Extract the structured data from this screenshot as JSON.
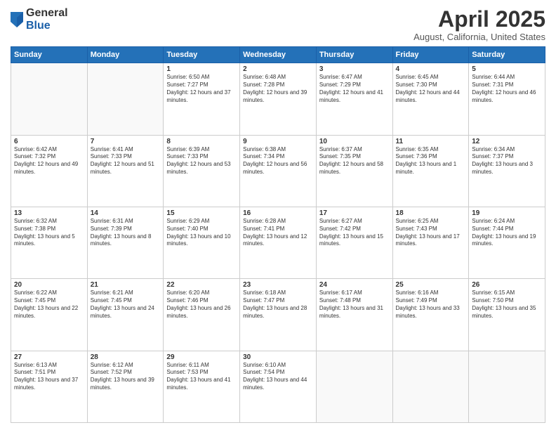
{
  "header": {
    "logo_general": "General",
    "logo_blue": "Blue",
    "title": "April 2025",
    "location": "August, California, United States"
  },
  "days_of_week": [
    "Sunday",
    "Monday",
    "Tuesday",
    "Wednesday",
    "Thursday",
    "Friday",
    "Saturday"
  ],
  "weeks": [
    [
      {
        "day": "",
        "info": ""
      },
      {
        "day": "",
        "info": ""
      },
      {
        "day": "1",
        "info": "Sunrise: 6:50 AM\nSunset: 7:27 PM\nDaylight: 12 hours and 37 minutes."
      },
      {
        "day": "2",
        "info": "Sunrise: 6:48 AM\nSunset: 7:28 PM\nDaylight: 12 hours and 39 minutes."
      },
      {
        "day": "3",
        "info": "Sunrise: 6:47 AM\nSunset: 7:29 PM\nDaylight: 12 hours and 41 minutes."
      },
      {
        "day": "4",
        "info": "Sunrise: 6:45 AM\nSunset: 7:30 PM\nDaylight: 12 hours and 44 minutes."
      },
      {
        "day": "5",
        "info": "Sunrise: 6:44 AM\nSunset: 7:31 PM\nDaylight: 12 hours and 46 minutes."
      }
    ],
    [
      {
        "day": "6",
        "info": "Sunrise: 6:42 AM\nSunset: 7:32 PM\nDaylight: 12 hours and 49 minutes."
      },
      {
        "day": "7",
        "info": "Sunrise: 6:41 AM\nSunset: 7:33 PM\nDaylight: 12 hours and 51 minutes."
      },
      {
        "day": "8",
        "info": "Sunrise: 6:39 AM\nSunset: 7:33 PM\nDaylight: 12 hours and 53 minutes."
      },
      {
        "day": "9",
        "info": "Sunrise: 6:38 AM\nSunset: 7:34 PM\nDaylight: 12 hours and 56 minutes."
      },
      {
        "day": "10",
        "info": "Sunrise: 6:37 AM\nSunset: 7:35 PM\nDaylight: 12 hours and 58 minutes."
      },
      {
        "day": "11",
        "info": "Sunrise: 6:35 AM\nSunset: 7:36 PM\nDaylight: 13 hours and 1 minute."
      },
      {
        "day": "12",
        "info": "Sunrise: 6:34 AM\nSunset: 7:37 PM\nDaylight: 13 hours and 3 minutes."
      }
    ],
    [
      {
        "day": "13",
        "info": "Sunrise: 6:32 AM\nSunset: 7:38 PM\nDaylight: 13 hours and 5 minutes."
      },
      {
        "day": "14",
        "info": "Sunrise: 6:31 AM\nSunset: 7:39 PM\nDaylight: 13 hours and 8 minutes."
      },
      {
        "day": "15",
        "info": "Sunrise: 6:29 AM\nSunset: 7:40 PM\nDaylight: 13 hours and 10 minutes."
      },
      {
        "day": "16",
        "info": "Sunrise: 6:28 AM\nSunset: 7:41 PM\nDaylight: 13 hours and 12 minutes."
      },
      {
        "day": "17",
        "info": "Sunrise: 6:27 AM\nSunset: 7:42 PM\nDaylight: 13 hours and 15 minutes."
      },
      {
        "day": "18",
        "info": "Sunrise: 6:25 AM\nSunset: 7:43 PM\nDaylight: 13 hours and 17 minutes."
      },
      {
        "day": "19",
        "info": "Sunrise: 6:24 AM\nSunset: 7:44 PM\nDaylight: 13 hours and 19 minutes."
      }
    ],
    [
      {
        "day": "20",
        "info": "Sunrise: 6:22 AM\nSunset: 7:45 PM\nDaylight: 13 hours and 22 minutes."
      },
      {
        "day": "21",
        "info": "Sunrise: 6:21 AM\nSunset: 7:45 PM\nDaylight: 13 hours and 24 minutes."
      },
      {
        "day": "22",
        "info": "Sunrise: 6:20 AM\nSunset: 7:46 PM\nDaylight: 13 hours and 26 minutes."
      },
      {
        "day": "23",
        "info": "Sunrise: 6:18 AM\nSunset: 7:47 PM\nDaylight: 13 hours and 28 minutes."
      },
      {
        "day": "24",
        "info": "Sunrise: 6:17 AM\nSunset: 7:48 PM\nDaylight: 13 hours and 31 minutes."
      },
      {
        "day": "25",
        "info": "Sunrise: 6:16 AM\nSunset: 7:49 PM\nDaylight: 13 hours and 33 minutes."
      },
      {
        "day": "26",
        "info": "Sunrise: 6:15 AM\nSunset: 7:50 PM\nDaylight: 13 hours and 35 minutes."
      }
    ],
    [
      {
        "day": "27",
        "info": "Sunrise: 6:13 AM\nSunset: 7:51 PM\nDaylight: 13 hours and 37 minutes."
      },
      {
        "day": "28",
        "info": "Sunrise: 6:12 AM\nSunset: 7:52 PM\nDaylight: 13 hours and 39 minutes."
      },
      {
        "day": "29",
        "info": "Sunrise: 6:11 AM\nSunset: 7:53 PM\nDaylight: 13 hours and 41 minutes."
      },
      {
        "day": "30",
        "info": "Sunrise: 6:10 AM\nSunset: 7:54 PM\nDaylight: 13 hours and 44 minutes."
      },
      {
        "day": "",
        "info": ""
      },
      {
        "day": "",
        "info": ""
      },
      {
        "day": "",
        "info": ""
      }
    ]
  ]
}
